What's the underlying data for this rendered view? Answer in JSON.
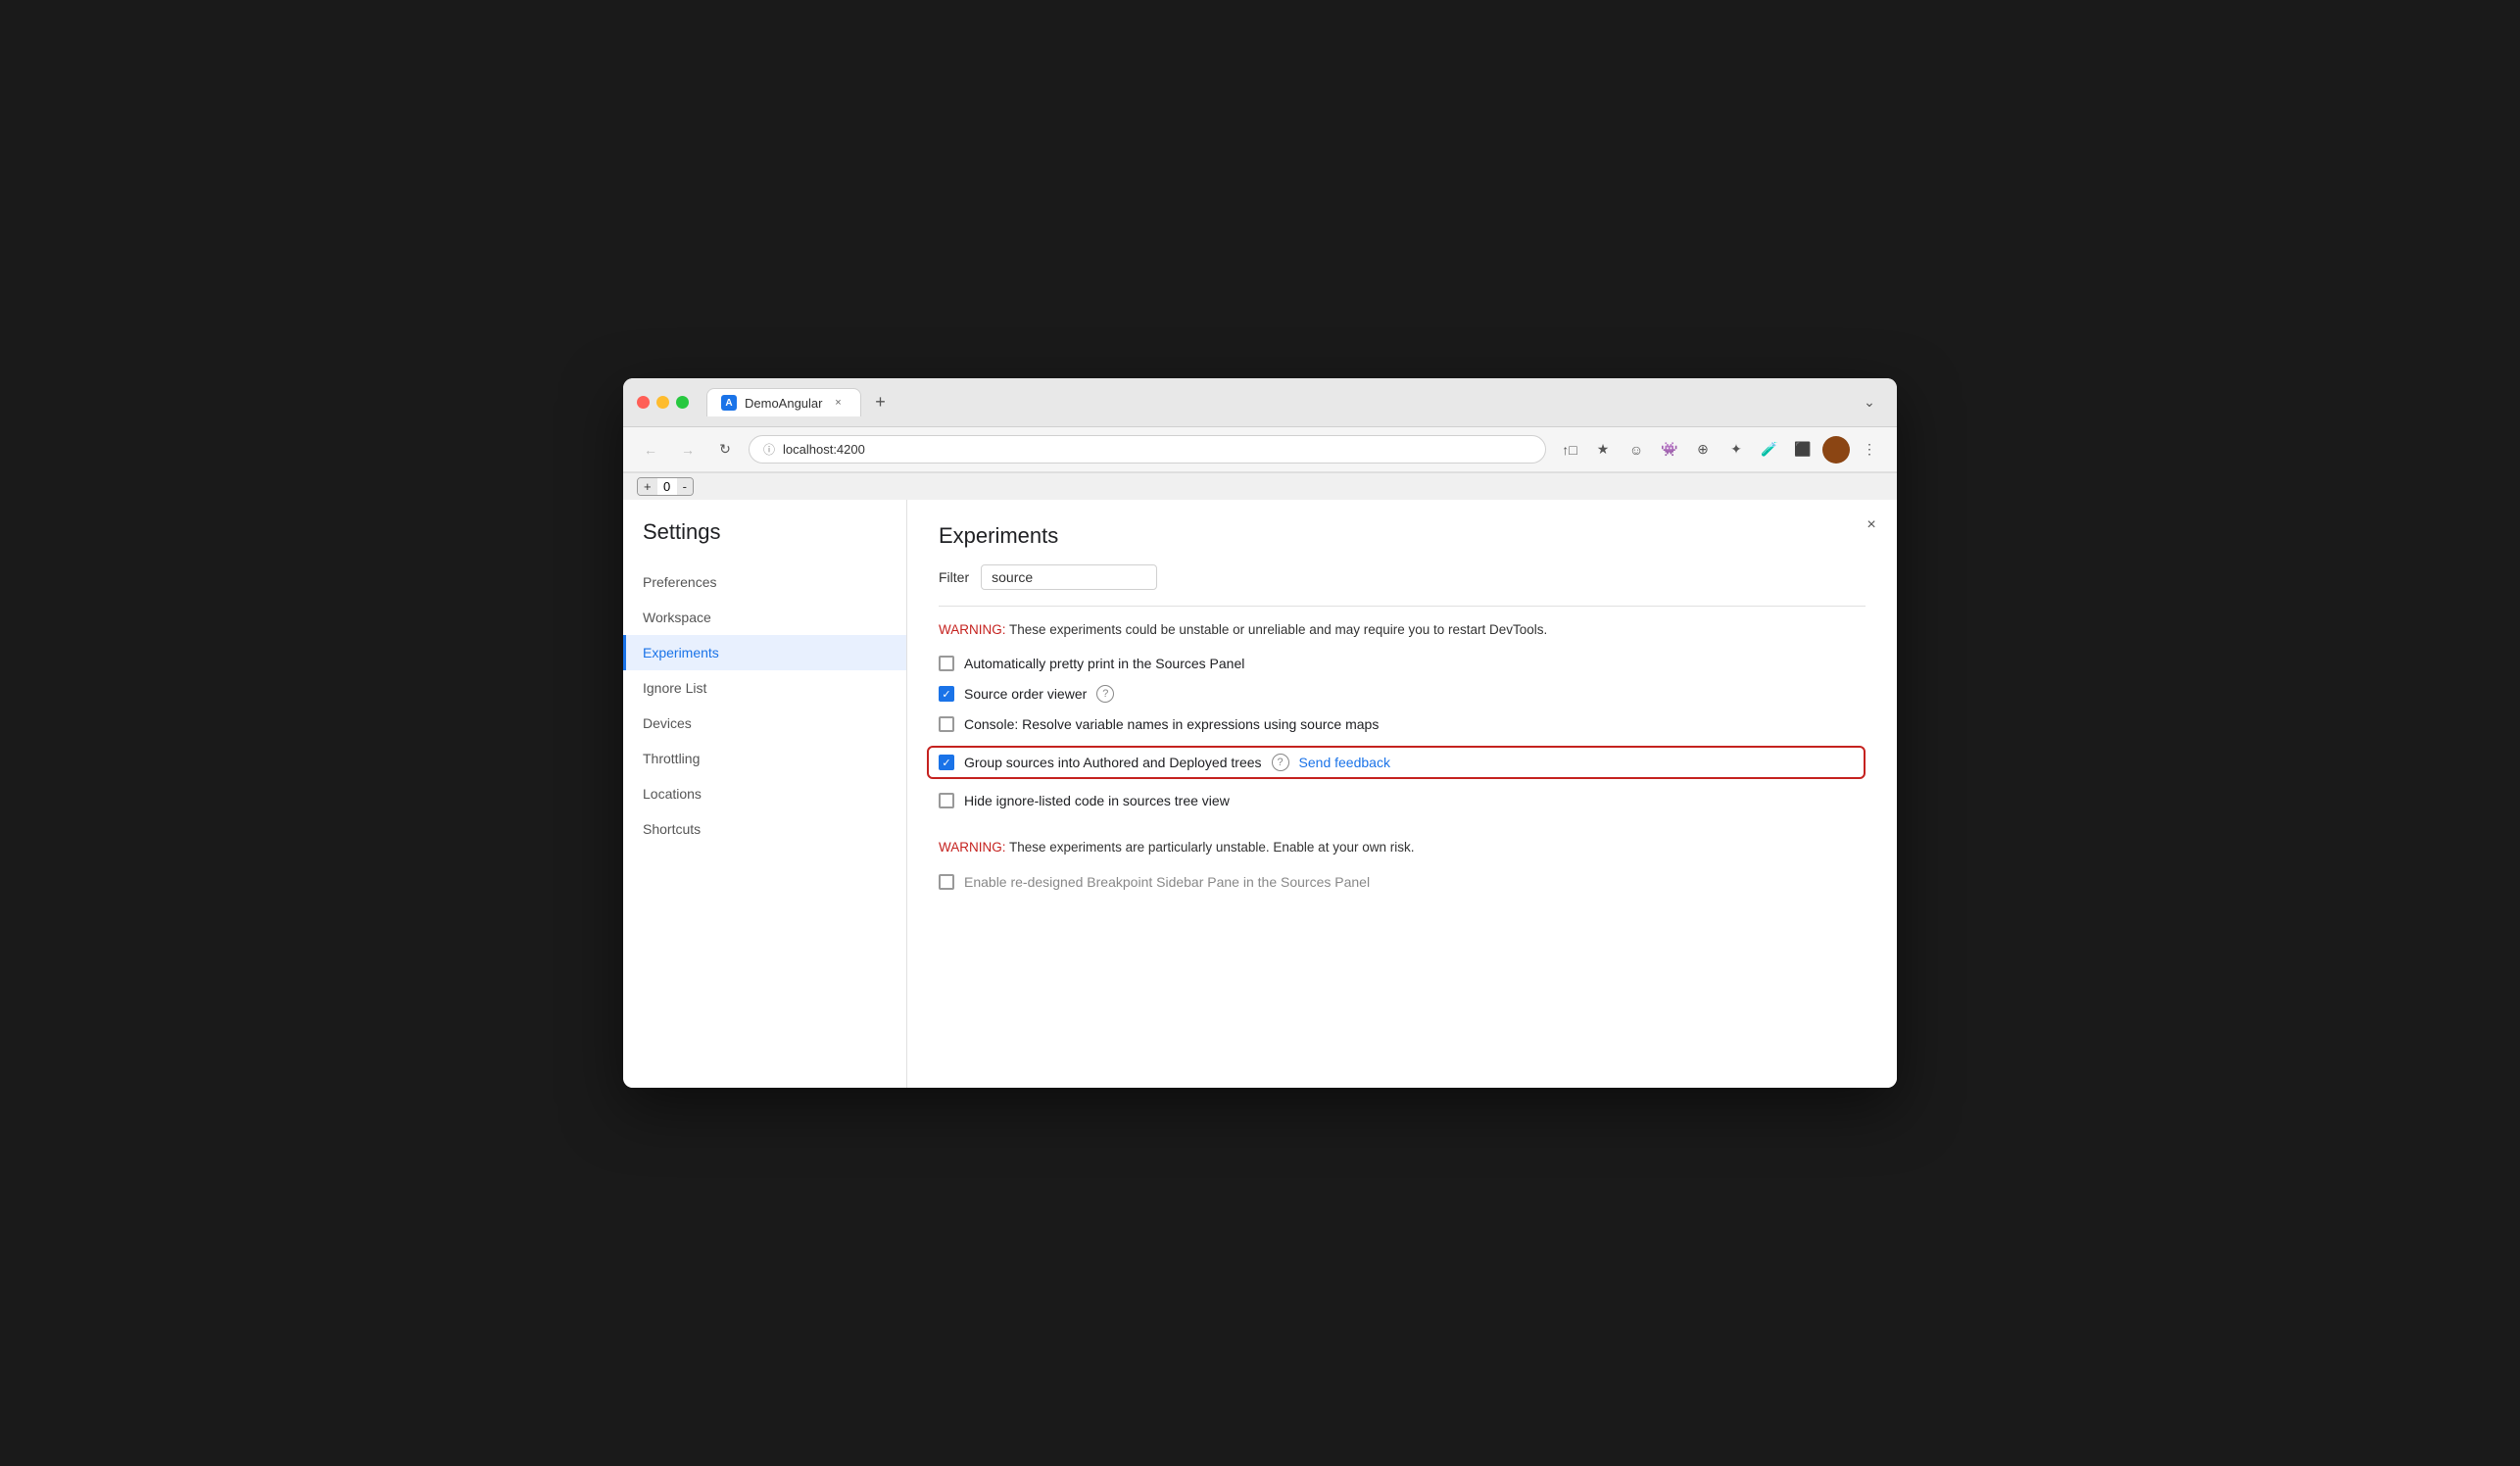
{
  "browser": {
    "tab_title": "DemoAngular",
    "tab_favicon": "A",
    "address": "localhost:4200",
    "new_tab_label": "+",
    "tab_close": "×",
    "nav": {
      "back": "←",
      "forward": "→",
      "reload": "↻",
      "more": "⋮",
      "dropdown": "⌄"
    },
    "toolbar_icons": [
      "↑□",
      "★",
      "☻",
      "👾",
      "⊕",
      "✦",
      "🧪",
      "⬛",
      "👤",
      "⋮"
    ]
  },
  "devtools": {
    "counter_minus": "-",
    "counter_value": "0",
    "counter_plus": "+"
  },
  "settings": {
    "title": "Settings",
    "close_btn": "×",
    "sidebar_items": [
      {
        "id": "preferences",
        "label": "Preferences",
        "active": false
      },
      {
        "id": "workspace",
        "label": "Workspace",
        "active": false
      },
      {
        "id": "experiments",
        "label": "Experiments",
        "active": true
      },
      {
        "id": "ignore-list",
        "label": "Ignore List",
        "active": false
      },
      {
        "id": "devices",
        "label": "Devices",
        "active": false
      },
      {
        "id": "throttling",
        "label": "Throttling",
        "active": false
      },
      {
        "id": "locations",
        "label": "Locations",
        "active": false
      },
      {
        "id": "shortcuts",
        "label": "Shortcuts",
        "active": false
      }
    ],
    "experiments": {
      "title": "Experiments",
      "filter_label": "Filter",
      "filter_value": "source",
      "filter_placeholder": "Filter",
      "warning1": "These experiments could be unstable or unreliable and may require you to restart DevTools.",
      "warning2": "These experiments are particularly unstable. Enable at your own risk.",
      "warning_prefix": "WARNING:",
      "items": [
        {
          "id": "pretty-print",
          "label": "Automatically pretty print in the Sources Panel",
          "checked": false,
          "highlighted": false,
          "has_help": false,
          "has_feedback": false
        },
        {
          "id": "source-order",
          "label": "Source order viewer",
          "checked": true,
          "highlighted": false,
          "has_help": true,
          "has_feedback": false
        },
        {
          "id": "console-resolve",
          "label": "Console: Resolve variable names in expressions using source maps",
          "checked": false,
          "highlighted": false,
          "has_help": false,
          "has_feedback": false
        },
        {
          "id": "group-sources",
          "label": "Group sources into Authored and Deployed trees",
          "checked": true,
          "highlighted": true,
          "has_help": true,
          "has_feedback": true,
          "feedback_label": "Send feedback"
        },
        {
          "id": "hide-ignore",
          "label": "Hide ignore-listed code in sources tree view",
          "checked": false,
          "highlighted": false,
          "has_help": false,
          "has_feedback": false
        }
      ],
      "unstable_item": {
        "id": "breakpoint-sidebar",
        "label": "Enable re-designed Breakpoint Sidebar Pane in the Sources Panel",
        "checked": false
      }
    }
  }
}
